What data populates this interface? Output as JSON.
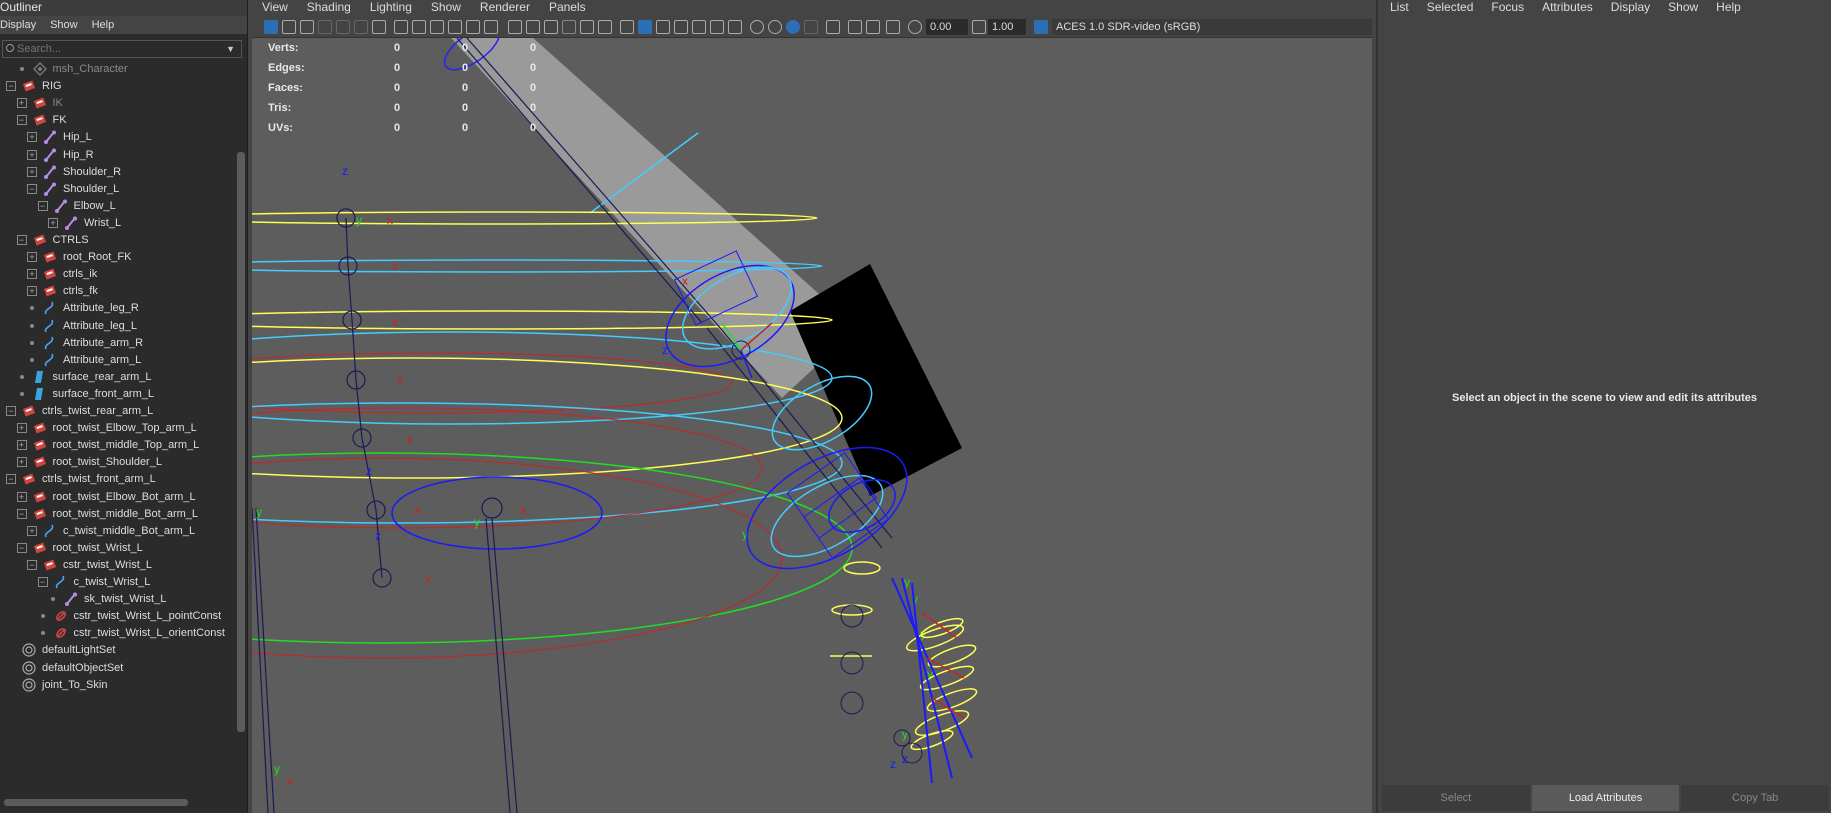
{
  "outliner": {
    "title": "Outliner",
    "menu": [
      "Display",
      "Show",
      "Help"
    ],
    "search_placeholder": "Search...",
    "items": [
      {
        "label": "msh_Character",
        "indent": 1,
        "type": "mesh",
        "expander": "none",
        "dim": true
      },
      {
        "label": "RIG",
        "indent": 0,
        "type": "group",
        "expander": "minus"
      },
      {
        "label": "IK",
        "indent": 1,
        "type": "group",
        "expander": "plus",
        "dim": true
      },
      {
        "label": "FK",
        "indent": 1,
        "type": "group",
        "expander": "minus"
      },
      {
        "label": "Hip_L",
        "indent": 2,
        "type": "joint",
        "expander": "plus"
      },
      {
        "label": "Hip_R",
        "indent": 2,
        "type": "joint",
        "expander": "plus"
      },
      {
        "label": "Shoulder_R",
        "indent": 2,
        "type": "joint",
        "expander": "plus"
      },
      {
        "label": "Shoulder_L",
        "indent": 2,
        "type": "joint",
        "expander": "minus"
      },
      {
        "label": "Elbow_L",
        "indent": 3,
        "type": "joint",
        "expander": "minus"
      },
      {
        "label": "Wrist_L",
        "indent": 4,
        "type": "joint",
        "expander": "plus"
      },
      {
        "label": "CTRLS",
        "indent": 1,
        "type": "group",
        "expander": "minus"
      },
      {
        "label": "root_Root_FK",
        "indent": 2,
        "type": "group",
        "expander": "plus"
      },
      {
        "label": "ctrls_ik",
        "indent": 2,
        "type": "group",
        "expander": "plus"
      },
      {
        "label": "ctrls_fk",
        "indent": 2,
        "type": "group",
        "expander": "plus"
      },
      {
        "label": "Attribute_leg_R",
        "indent": 2,
        "type": "curve",
        "expander": "none"
      },
      {
        "label": "Attribute_leg_L",
        "indent": 2,
        "type": "curve",
        "expander": "none"
      },
      {
        "label": "Attribute_arm_R",
        "indent": 2,
        "type": "curve",
        "expander": "none"
      },
      {
        "label": "Attribute_arm_L",
        "indent": 2,
        "type": "curve",
        "expander": "none"
      },
      {
        "label": "surface_rear_arm_L",
        "indent": 1,
        "type": "surface",
        "expander": "none"
      },
      {
        "label": "surface_front_arm_L",
        "indent": 1,
        "type": "surface",
        "expander": "none"
      },
      {
        "label": "ctrls_twist_rear_arm_L",
        "indent": 0,
        "type": "group",
        "expander": "minus"
      },
      {
        "label": "root_twist_Elbow_Top_arm_L",
        "indent": 1,
        "type": "group",
        "expander": "plus"
      },
      {
        "label": "root_twist_middle_Top_arm_L",
        "indent": 1,
        "type": "group",
        "expander": "plus"
      },
      {
        "label": "root_twist_Shoulder_L",
        "indent": 1,
        "type": "group",
        "expander": "plus"
      },
      {
        "label": "ctrls_twist_front_arm_L",
        "indent": 0,
        "type": "group",
        "expander": "minus"
      },
      {
        "label": "root_twist_Elbow_Bot_arm_L",
        "indent": 1,
        "type": "group",
        "expander": "plus"
      },
      {
        "label": "root_twist_middle_Bot_arm_L",
        "indent": 1,
        "type": "group",
        "expander": "minus"
      },
      {
        "label": "c_twist_middle_Bot_arm_L",
        "indent": 2,
        "type": "curve",
        "expander": "plus"
      },
      {
        "label": "root_twist_Wrist_L",
        "indent": 1,
        "type": "group",
        "expander": "minus"
      },
      {
        "label": "cstr_twist_Wrist_L",
        "indent": 2,
        "type": "group",
        "expander": "minus"
      },
      {
        "label": "c_twist_Wrist_L",
        "indent": 3,
        "type": "curve",
        "expander": "minus"
      },
      {
        "label": "sk_twist_Wrist_L",
        "indent": 4,
        "type": "joint",
        "expander": "none"
      },
      {
        "label": "cstr_twist_Wrist_L_pointConst",
        "indent": 3,
        "type": "constraint",
        "expander": "none"
      },
      {
        "label": "cstr_twist_Wrist_L_orientConst",
        "indent": 3,
        "type": "constraint",
        "expander": "none"
      },
      {
        "label": "defaultLightSet",
        "indent": 0,
        "type": "set",
        "expander": "none"
      },
      {
        "label": "defaultObjectSet",
        "indent": 0,
        "type": "set",
        "expander": "none"
      },
      {
        "label": "joint_To_Skin",
        "indent": 0,
        "type": "set",
        "expander": "none"
      }
    ]
  },
  "viewport": {
    "menu": [
      "View",
      "Shading",
      "Lighting",
      "Show",
      "Renderer",
      "Panels"
    ],
    "exposure": "0.00",
    "gamma": "1.00",
    "color_space": "ACES 1.0 SDR-video (sRGB)",
    "hud": [
      {
        "label": "Verts:",
        "a": "0",
        "b": "0",
        "c": "0"
      },
      {
        "label": "Edges:",
        "a": "0",
        "b": "0",
        "c": "0"
      },
      {
        "label": "Faces:",
        "a": "0",
        "b": "0",
        "c": "0"
      },
      {
        "label": "Tris:",
        "a": "0",
        "b": "0",
        "c": "0"
      },
      {
        "label": "UVs:",
        "a": "0",
        "b": "0",
        "c": "0"
      }
    ],
    "axis_labels": {
      "x": "x",
      "y": "y",
      "z": "z"
    }
  },
  "attribute_editor": {
    "menu": [
      "List",
      "Selected",
      "Focus",
      "Attributes",
      "Display",
      "Show",
      "Help"
    ],
    "message": "Select an object in the scene to view and edit its attributes",
    "tabs": [
      {
        "label": "Select",
        "active": false
      },
      {
        "label": "Load Attributes",
        "active": true
      },
      {
        "label": "Copy Tab",
        "active": false
      }
    ]
  },
  "colors": {
    "group_icon": "#d0453f",
    "joint_icon": "#b78ce6",
    "curve_icon": "#4aa3ff",
    "surface_icon": "#3aa5d8",
    "constraint_icon": "#d0453f",
    "ctrl_yellow": "#ffff55",
    "ctrl_cyan": "#44ccff",
    "ctrl_red": "#cc2222",
    "ctrl_green": "#22dd22",
    "ctrl_blue": "#1a1aff",
    "joint_line": "#1a1a55"
  }
}
